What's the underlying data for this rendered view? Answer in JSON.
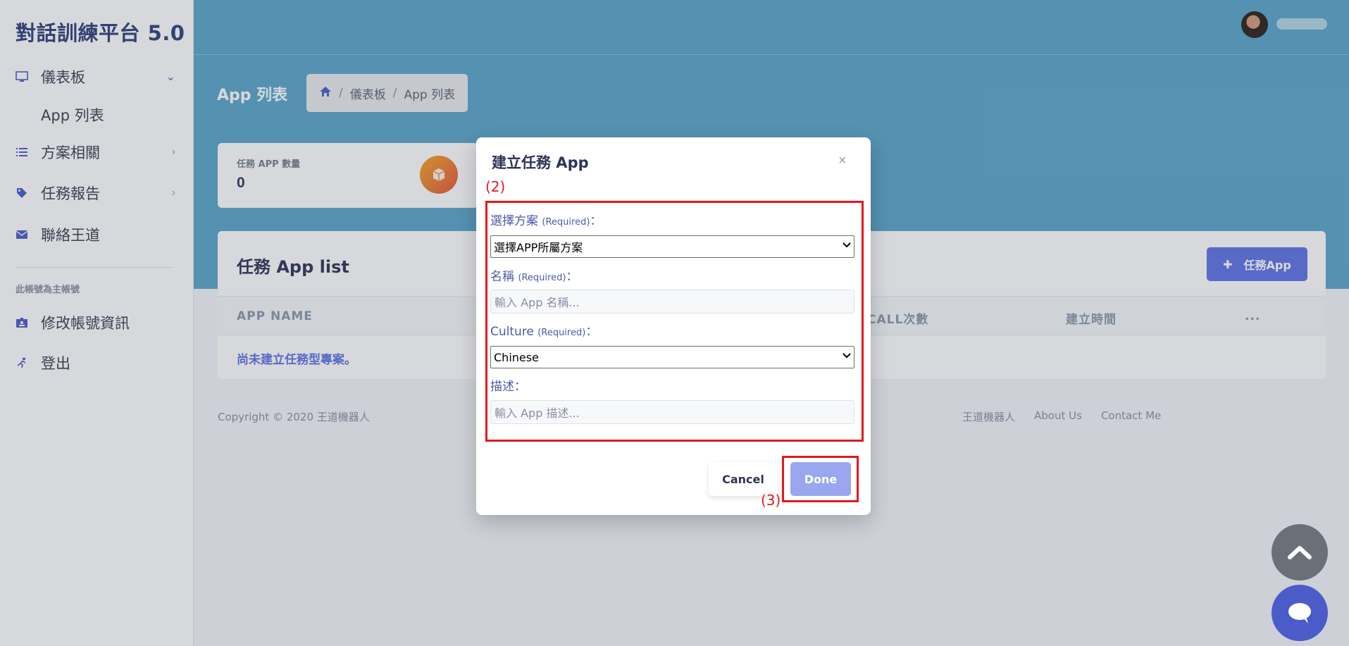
{
  "sidebar": {
    "brand": "對話訓練平台 5.0",
    "items": [
      {
        "label": "儀表板",
        "icon": "monitor-icon"
      },
      {
        "label": "App 列表"
      },
      {
        "label": "方案相關",
        "icon": "list-icon"
      },
      {
        "label": "任務報告",
        "icon": "tag-icon"
      },
      {
        "label": "聯絡王道",
        "icon": "envelope-icon"
      }
    ],
    "section_label": "此帳號為主帳號",
    "account_items": [
      {
        "label": "修改帳號資訊",
        "icon": "id-card-icon"
      },
      {
        "label": "登出",
        "icon": "running-icon"
      }
    ]
  },
  "header": {
    "page_title": "App 列表",
    "breadcrumb": [
      "儀表板",
      "App 列表"
    ],
    "breadcrumb_sep": "/"
  },
  "stat_card": {
    "title": "任務 APP 數量",
    "value": "0",
    "icon": "cube-icon"
  },
  "list": {
    "title": "任務 App list",
    "add_button_label": "任務App",
    "columns": [
      "APP NAME",
      "CALL次數",
      "建立時間",
      "..."
    ],
    "empty_message": "尚未建立任務型專案。"
  },
  "footer": {
    "copyright": "Copyright © 2020 王道機器人",
    "links": [
      "王道機器人",
      "About Us",
      "Contact Me"
    ]
  },
  "modal": {
    "title": "建立任務 App",
    "close": "×",
    "annotation_2": "(2)",
    "annotation_3": "(3)",
    "fields": {
      "plan_label": "選擇方案",
      "plan_required": "(Required)",
      "plan_selected": "選擇APP所屬方案",
      "name_label": "名稱",
      "name_required": "(Required)",
      "name_placeholder": "輸入 App 名稱...",
      "culture_label": "Culture",
      "culture_required": "(Required)",
      "culture_selected": "Chinese",
      "desc_label": "描述",
      "desc_placeholder": "輸入 App 描述..."
    },
    "cancel_label": "Cancel",
    "done_label": "Done"
  },
  "colors": {
    "hero": "#5aa5c9",
    "accent": "#5e72e4",
    "annotation_red": "#e0191e"
  }
}
